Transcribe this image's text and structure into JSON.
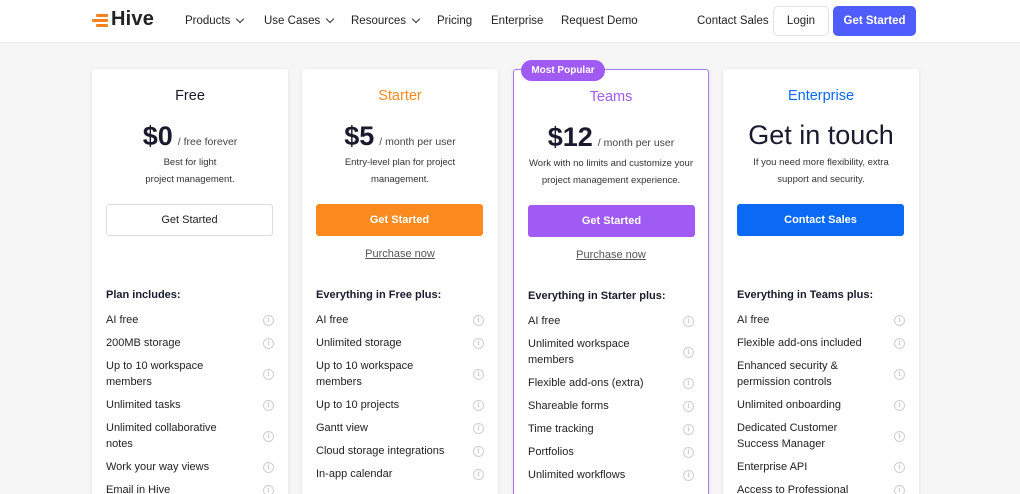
{
  "brand": {
    "name": "Hive"
  },
  "nav": {
    "items": [
      {
        "label": "Products",
        "dropdown": true
      },
      {
        "label": "Use Cases",
        "dropdown": true
      },
      {
        "label": "Resources",
        "dropdown": true
      },
      {
        "label": "Pricing",
        "dropdown": false
      },
      {
        "label": "Enterprise",
        "dropdown": false
      },
      {
        "label": "Request Demo",
        "dropdown": false
      }
    ],
    "contact_sales": "Contact Sales",
    "login": "Login",
    "get_started": "Get Started"
  },
  "colors": {
    "brand_orange": "#f5821f",
    "primary_blue": "#4f5dfc",
    "starter_orange": "#fc8a1f",
    "teams_purple": "#a15bf5",
    "enterprise_blue": "#0a69f5"
  },
  "plans": [
    {
      "name": "Free",
      "name_color": "#1a1a2e",
      "price": "$0",
      "price_suffix": "/ free forever",
      "desc_line1": "Best for light",
      "desc_line2": "project management.",
      "cta": "Get Started",
      "purchase": "",
      "features_title": "Plan includes:",
      "features": [
        "AI free",
        "200MB storage",
        "Up to 10 workspace members",
        "Unlimited tasks",
        "Unlimited collaborative notes",
        "Work your way views",
        "Email in Hive"
      ]
    },
    {
      "name": "Starter",
      "name_color": "#fc8a1f",
      "price": "$5",
      "price_suffix": "/ month per user",
      "desc_line1": "Entry-level plan for project",
      "desc_line2": "management.",
      "cta": "Get Started",
      "purchase": "Purchase now",
      "features_title": "Everything in Free plus:",
      "features": [
        "AI free",
        "Unlimited storage",
        "Up to 10 workspace members",
        "Up to 10 projects",
        "Gantt view",
        "Cloud storage integrations",
        "In-app calendar"
      ]
    },
    {
      "name": "Teams",
      "name_color": "#a15bf5",
      "badge": "Most Popular",
      "price": "$12",
      "price_suffix": "/ month per user",
      "desc_line1": "Work with no limits and customize your",
      "desc_line2": "project management experience.",
      "cta": "Get Started",
      "purchase": "Purchase now",
      "features_title": "Everything in Starter plus:",
      "features": [
        "AI free",
        "Unlimited workspace members",
        "Flexible add-ons (extra)",
        "Shareable forms",
        "Time tracking",
        "Portfolios",
        "Unlimited workflows"
      ]
    },
    {
      "name": "Enterprise",
      "name_color": "#0a69f5",
      "big_text": "Get in touch",
      "desc_line1": "If you need more flexibility, extra",
      "desc_line2": "support and security.",
      "cta": "Contact Sales",
      "purchase": "",
      "features_title": "Everything in Teams plus:",
      "features": [
        "AI free",
        "Flexible add-ons included",
        "Enhanced security & permission controls",
        "Unlimited onboarding",
        "Dedicated Customer Success Manager",
        "Enterprise API",
        "Access to Professional"
      ]
    }
  ]
}
